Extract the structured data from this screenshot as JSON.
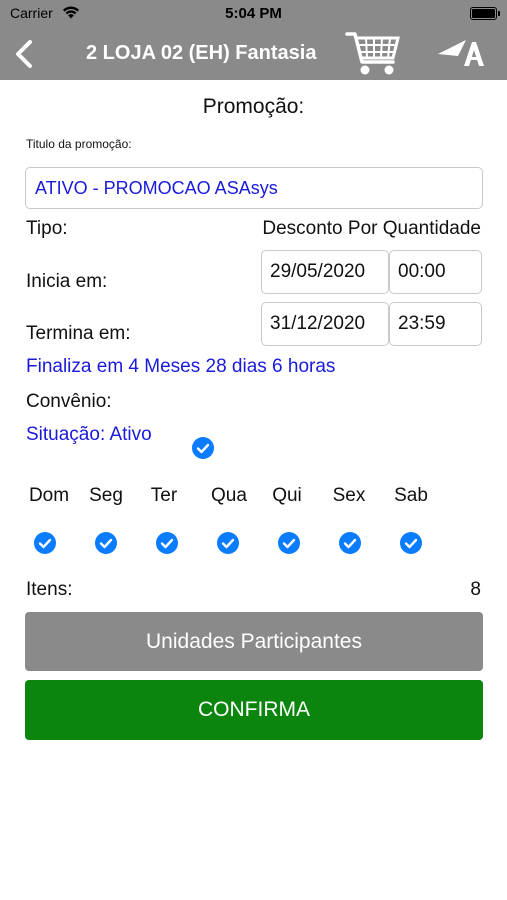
{
  "status_bar": {
    "carrier": "Carrier",
    "time": "5:04 PM"
  },
  "nav": {
    "title": "2 LOJA 02 (EH) Fantasia",
    "back_icon": "chevron-left-icon",
    "cart_icon": "shopping-cart-icon",
    "logo_icon": "brand-logo-icon"
  },
  "page": {
    "section_title": "Promoção:"
  },
  "promo": {
    "title_label": "Titulo da promoção:",
    "title_value": "ATIVO - PROMOCAO ASAsys"
  },
  "tipo": {
    "label": "Tipo:",
    "value": "Desconto Por Quantidade"
  },
  "inicia": {
    "label": "Inicia em:",
    "date": "29/05/2020",
    "time": "00:00"
  },
  "termina": {
    "label": "Termina em:",
    "date": "31/12/2020",
    "time": "23:59"
  },
  "finaliza": "Finaliza em 4 Meses 28 dias 6 horas",
  "convenio": {
    "label": "Convênio:"
  },
  "situacao": {
    "label": "Situação: Ativo",
    "checked": true
  },
  "days": [
    {
      "label": "Dom",
      "checked": true
    },
    {
      "label": "Seg",
      "checked": true
    },
    {
      "label": "Ter",
      "checked": true
    },
    {
      "label": "Qua",
      "checked": true
    },
    {
      "label": "Qui",
      "checked": true
    },
    {
      "label": "Sex",
      "checked": true
    },
    {
      "label": "Sab",
      "checked": true
    }
  ],
  "itens": {
    "label": "Itens:",
    "count": "8"
  },
  "buttons": {
    "unidades": "Unidades Participantes",
    "confirma": "CONFIRMA"
  },
  "colors": {
    "nav_bg": "#8a8a8a",
    "accent_blue": "#1a1adb",
    "check_blue": "#0a7cff",
    "confirm_green": "#0b850e"
  }
}
